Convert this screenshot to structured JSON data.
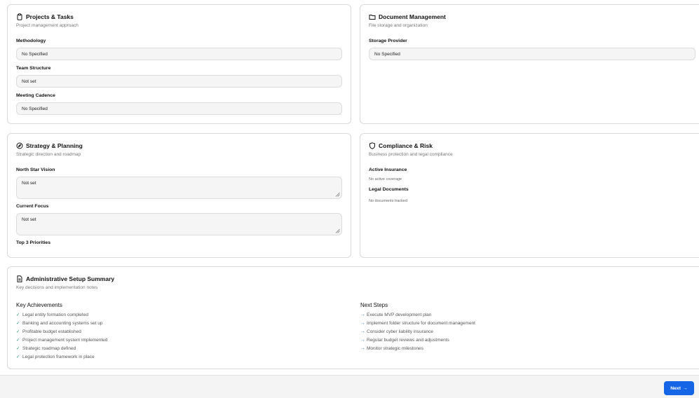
{
  "projects": {
    "title": "Projects & Tasks",
    "subtitle": "Project management approach",
    "methodology_label": "Methodology",
    "methodology_value": "No Specified",
    "team_label": "Team Structure",
    "team_value": "Not set",
    "cadence_label": "Meeting Cadence",
    "cadence_value": "No Specified"
  },
  "documents": {
    "title": "Document Management",
    "subtitle": "File storage and organization",
    "storage_label": "Storage Provider",
    "storage_value": "No Specified"
  },
  "strategy": {
    "title": "Strategy & Planning",
    "subtitle": "Strategic direction and roadmap",
    "vision_label": "North Star Vision",
    "vision_value": "Not set",
    "focus_label": "Current Focus",
    "focus_value": "Not set",
    "priorities_label": "Top 3 Priorities"
  },
  "compliance": {
    "title": "Compliance & Risk",
    "subtitle": "Business protection and legal compliance",
    "insurance_label": "Active Insurance",
    "insurance_value": "No active coverage",
    "legal_label": "Legal Documents",
    "legal_value": "No documents tracked"
  },
  "summary": {
    "title": "Administrative Setup Summary",
    "subtitle": "Key decisions and implementation notes",
    "achievements_title": "Key Achievements",
    "achievements": [
      "Legal entity formation completed",
      "Banking and accounting systems set up",
      "Profitable budget established",
      "Project management system implemented",
      "Strategic roadmap defined",
      "Legal protection framework in place"
    ],
    "next_title": "Next Steps",
    "next_steps": [
      "Execute MVP development plan",
      "Implement folder structure for document management",
      "Consider cyber liability insurance",
      "Regular budget reviews and adjustments",
      "Monitor strategic milestones"
    ]
  },
  "footer": {
    "next_label": "Next",
    "next_arrow": "→"
  },
  "colors": {
    "accent": "#1565e6",
    "check": "#22a06b"
  }
}
